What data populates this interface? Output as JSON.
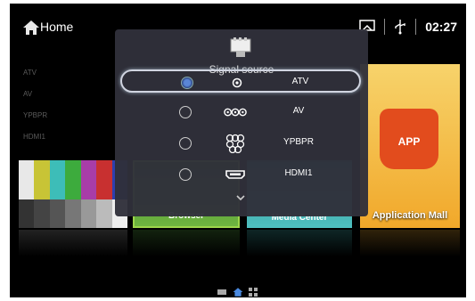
{
  "topbar": {
    "home_label": "Home",
    "clock": "02:27"
  },
  "background": {
    "source_list": [
      "ATV",
      "AV",
      "YPBPR",
      "HDMI1"
    ],
    "tiles": {
      "browser": "Browser",
      "media": "Media Center",
      "app_mall": "Application Mall",
      "app_badge": "APP"
    }
  },
  "dialog": {
    "title": "Signal source",
    "items": [
      {
        "label": "ATV",
        "icon": "antenna-jack-icon",
        "selected": true
      },
      {
        "label": "AV",
        "icon": "rca-jacks-icon",
        "selected": false
      },
      {
        "label": "YPBPR",
        "icon": "component-jacks-icon",
        "selected": false
      },
      {
        "label": "HDMI1",
        "icon": "hdmi-port-icon",
        "selected": false
      }
    ]
  },
  "colors": {
    "dialog_bg": "#30303a",
    "accent": "#5a86d6"
  }
}
